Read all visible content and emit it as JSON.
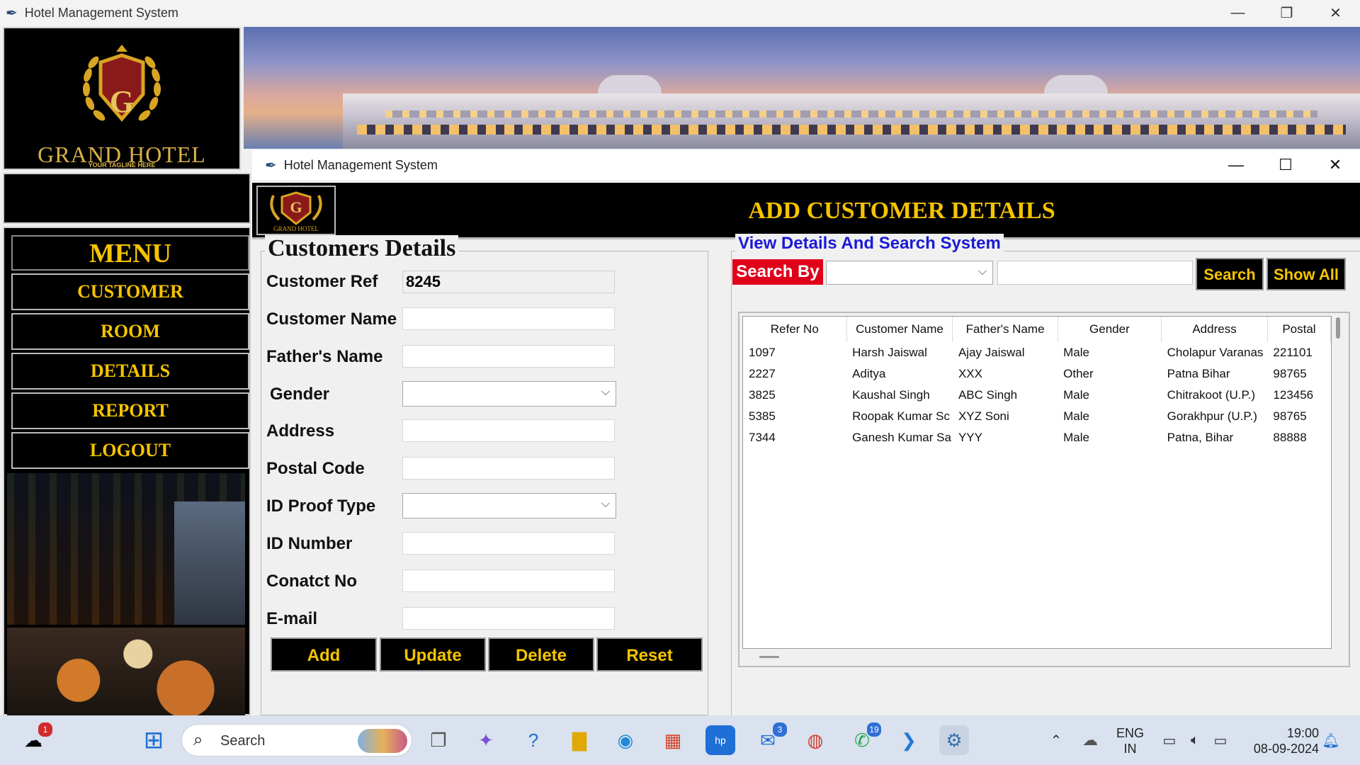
{
  "outer_window": {
    "title": "Hotel Management System",
    "controls": [
      "—",
      "❐",
      "✕"
    ]
  },
  "logo": {
    "name": "GRAND HOTEL",
    "tagline": "YOUR TAGLINE HERE",
    "letter": "G"
  },
  "menu": {
    "title": "MENU",
    "items": [
      {
        "label": "CUSTOMER"
      },
      {
        "label": "ROOM"
      },
      {
        "label": "DETAILS"
      },
      {
        "label": "REPORT"
      },
      {
        "label": "LOGOUT"
      }
    ]
  },
  "inner_window": {
    "title": "Hotel Management System",
    "controls": [
      "—",
      "☐",
      "✕"
    ],
    "header_title": "ADD CUSTOMER DETAILS"
  },
  "customer_form": {
    "legend": "Customers Details",
    "fields": [
      {
        "label": "Customer Ref",
        "value": "8245",
        "type": "readonly"
      },
      {
        "label": "Customer Name",
        "value": "",
        "type": "text"
      },
      {
        "label": "Father's Name",
        "value": "",
        "type": "text"
      },
      {
        "label": "Gender",
        "value": "",
        "type": "select"
      },
      {
        "label": "Address",
        "value": "",
        "type": "text"
      },
      {
        "label": "Postal Code",
        "value": "",
        "type": "text"
      },
      {
        "label": "ID Proof Type",
        "value": "",
        "type": "select"
      },
      {
        "label": "ID Number",
        "value": "",
        "type": "text"
      },
      {
        "label": "Conatct No",
        "value": "",
        "type": "text"
      },
      {
        "label": "E-mail",
        "value": "",
        "type": "text"
      }
    ],
    "buttons": {
      "add": "Add",
      "update": "Update",
      "delete": "Delete",
      "reset": "Reset"
    }
  },
  "view_panel": {
    "legend": "View Details And Search System",
    "search_by_label": "Search By",
    "search_combo_value": "",
    "search_text_value": "",
    "search_button": "Search",
    "show_all_button": "Show All",
    "table": {
      "columns": [
        "Refer No",
        "Customer Name",
        "Father's Name",
        "Gender",
        "Address",
        "Postal"
      ],
      "rows": [
        [
          "1097",
          "Harsh Jaiswal",
          "Ajay Jaiswal",
          "Male",
          "Cholapur Varanas",
          "221101"
        ],
        [
          "2227",
          "Aditya",
          "XXX",
          "Other",
          "Patna Bihar",
          "98765"
        ],
        [
          "3825",
          "Kaushal Singh",
          "ABC Singh",
          "Male",
          "Chitrakoot (U.P.)",
          "123456"
        ],
        [
          "5385",
          "Roopak Kumar Sc",
          "XYZ Soni",
          "Male",
          "Gorakhpur (U.P.)",
          "98765"
        ],
        [
          "7344",
          "Ganesh Kumar Sa",
          "YYY",
          "Male",
          "Patna, Bihar",
          "88888"
        ]
      ]
    }
  },
  "taskbar": {
    "weather_badge": "1",
    "search_placeholder": "Search",
    "outlook_badge": "3",
    "whatsapp_badge": "19",
    "lang_line1": "ENG",
    "lang_line2": "IN",
    "time": "19:00",
    "date": "08-09-2024"
  },
  "colors": {
    "accent_gold": "#f5c400",
    "search_red": "#e0001a",
    "legend_blue": "#1a1ad6"
  }
}
